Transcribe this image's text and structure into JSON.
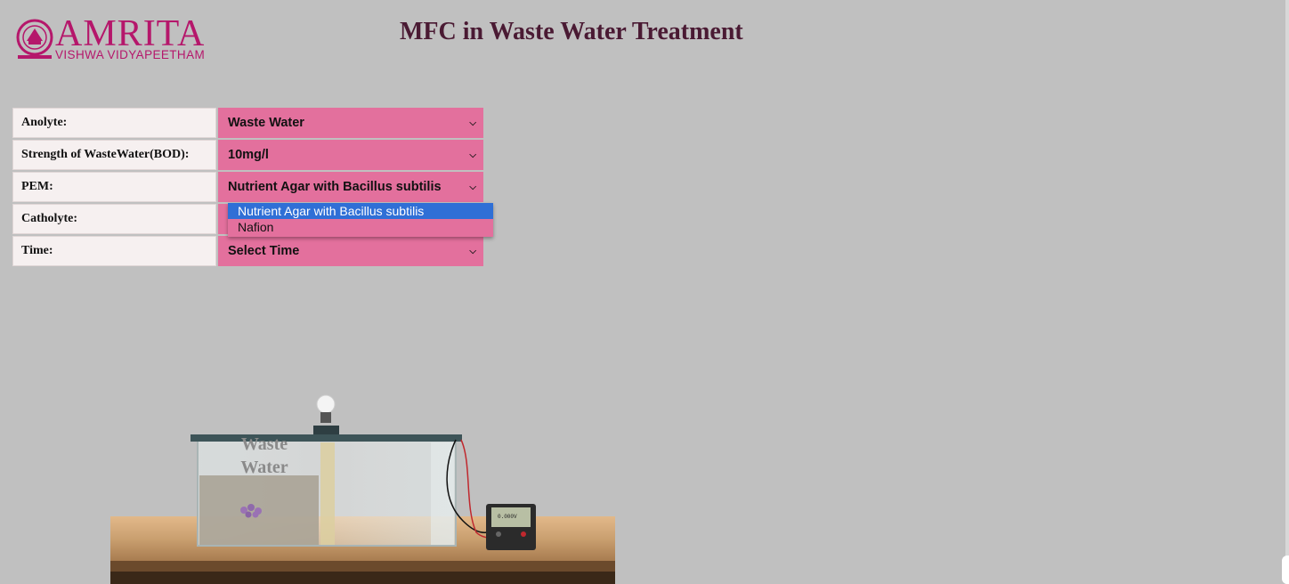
{
  "header": {
    "logo_main": "AMRITA",
    "logo_sub": "VISHWA VIDYAPEETHAM",
    "title": "MFC in Waste Water Treatment"
  },
  "controls": {
    "rows": [
      {
        "label": "Anolyte:",
        "value": "Waste Water"
      },
      {
        "label": "Strength of WasteWater(BOD):",
        "value": "10mg/l"
      },
      {
        "label": "PEM:",
        "value": "Nutrient Agar with Bacillus subtilis"
      },
      {
        "label": "Catholyte:",
        "value": ""
      },
      {
        "label": "Time:",
        "value": "Select Time"
      }
    ]
  },
  "pem_dropdown": {
    "options": [
      "Nutrient Agar with Bacillus subtilis",
      "Nafion"
    ],
    "highlighted": "Nutrient Agar with Bacillus subtilis"
  },
  "scene": {
    "tank_label": "Waste Water",
    "meter_reading": "0.000V"
  },
  "colors": {
    "background": "#c0c0c0",
    "brand": "#b5176b",
    "select_bg": "#e3709d",
    "highlight": "#2f6fd6",
    "title": "#4a1a33"
  }
}
